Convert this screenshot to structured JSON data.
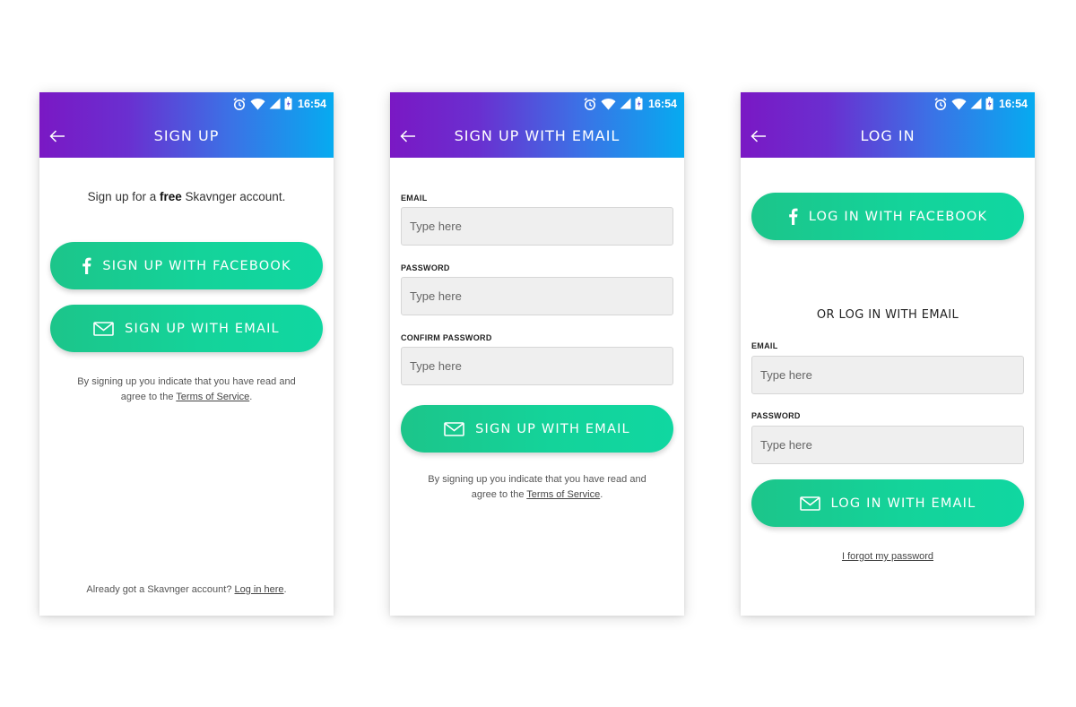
{
  "status": {
    "time": "16:54"
  },
  "icons": {
    "back": "arrow-left-icon",
    "facebook": "facebook-f-icon",
    "email": "envelope-icon",
    "alarm": "alarm-clock-icon",
    "wifi": "wifi-icon",
    "signal": "cell-signal-icon",
    "battery": "battery-charging-icon"
  },
  "colors": {
    "header_gradient": [
      "#7a18c4",
      "#06abf0"
    ],
    "button_gradient": [
      "#1cc58a",
      "#10d7a1"
    ],
    "field_bg": "#efefef"
  },
  "signup": {
    "title": "SIGN UP",
    "intro_before": "Sign up for a ",
    "intro_bold": "free",
    "intro_after": " Skavnger account.",
    "facebook_button": "SIGN UP WITH FACEBOOK",
    "email_button": "SIGN UP WITH EMAIL",
    "terms_line1": "By signing up you indicate that you have read and",
    "terms_line2_before": "agree to the ",
    "terms_link": "Terms of Service",
    "terms_line2_after": ".",
    "footer_before": "Already got a Skavnger account? ",
    "footer_link": "Log in here",
    "footer_after": "."
  },
  "signup_email": {
    "title": "SIGN UP WITH EMAIL",
    "email_label": "EMAIL",
    "email_placeholder": "Type here",
    "password_label": "PASSWORD",
    "password_placeholder": "Type here",
    "confirm_label": "CONFIRM PASSWORD",
    "confirm_placeholder": "Type here",
    "submit_button": "SIGN UP WITH EMAIL",
    "terms_line1": "By signing up you indicate that you have read and",
    "terms_line2_before": "agree to the ",
    "terms_link": "Terms of Service",
    "terms_line2_after": "."
  },
  "login": {
    "title": "LOG IN",
    "facebook_button": "LOG IN WITH FACEBOOK",
    "or_heading": "OR LOG IN WITH EMAIL",
    "email_label": "EMAIL",
    "email_placeholder": "Type here",
    "password_label": "PASSWORD",
    "password_placeholder": "Type here",
    "submit_button": "LOG IN WITH EMAIL",
    "forgot_link": "I forgot my password"
  }
}
